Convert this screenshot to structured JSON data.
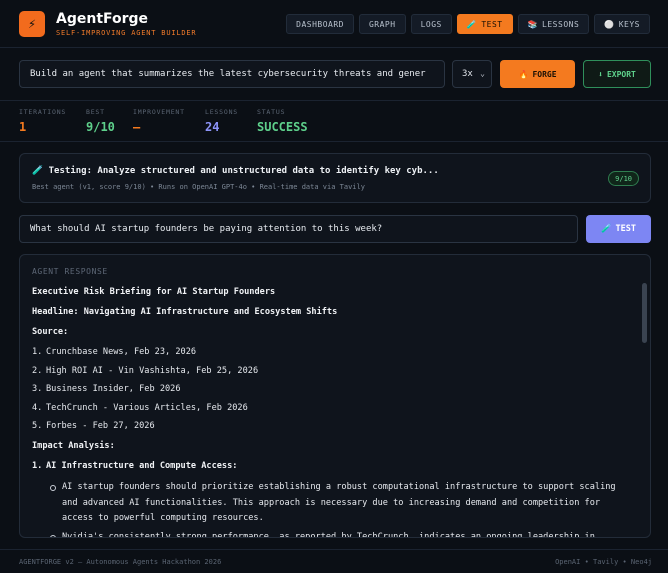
{
  "brand": {
    "logo_glyph": "⚡",
    "title": "AgentForge",
    "subtitle": "SELF-IMPROVING AGENT BUILDER"
  },
  "nav": {
    "dashboard": "DASHBOARD",
    "graph": "GRAPH",
    "logs": "LOGS",
    "test": "TEST",
    "test_icon": "🧪",
    "lessons": "LESSONS",
    "lessons_icon": "📚",
    "keys": "KEYS",
    "keys_icon": "⚪"
  },
  "prompt": {
    "value": "Build an agent that summarizes the latest cybersecurity threats and gener",
    "multiplier": "3x",
    "forge_label": "FORGE",
    "forge_icon": "🔥",
    "export_label": "EXPORT",
    "export_icon": "⬇"
  },
  "stats": {
    "iterations_label": "ITERATIONS",
    "iterations_value": "1",
    "best_label": "BEST",
    "best_value": "9/10",
    "improvement_label": "IMPROVEMENT",
    "improvement_value": "—",
    "lessons_label": "LESSONS",
    "lessons_value": "24",
    "status_label": "STATUS",
    "status_value": "SUCCESS"
  },
  "test_card": {
    "icon": "🧪",
    "title": "Testing: Analyze structured and unstructured data to identify key cyb...",
    "subtitle": "Best agent (v1, score 9/10) • Runs on OpenAI GPT-4o • Real-time data via Tavily",
    "score": "9/10"
  },
  "question": {
    "value": "What should AI startup founders be paying attention to this week?",
    "test_label": "TEST",
    "test_icon": "🧪"
  },
  "response": {
    "label": "AGENT RESPONSE",
    "heading1": "Executive Risk Briefing for AI Startup Founders",
    "heading2": "Headline: Navigating AI Infrastructure and Ecosystem Shifts",
    "source_heading": "Source:",
    "sources": [
      {
        "num": "1.",
        "text": "Crunchbase News, Feb 23, 2026"
      },
      {
        "num": "2.",
        "text": "High ROI AI - Vin Vashishta, Feb 25, 2026"
      },
      {
        "num": "3.",
        "text": "Business Insider, Feb 2026"
      },
      {
        "num": "4.",
        "text": "TechCrunch - Various Articles, Feb 2026"
      },
      {
        "num": "5.",
        "text": "Forbes - Feb 27, 2026"
      }
    ],
    "impact_heading": "Impact Analysis:",
    "impact_item_num": "1.",
    "impact_item_title": "AI Infrastructure and Compute Access:",
    "bullet1": "AI startup founders should prioritize establishing a robust computational infrastructure to support scaling and advanced AI functionalities. This approach is necessary due to increasing demand and competition for access to powerful computing resources.",
    "bullet2": "Nvidia's consistently strong performance, as reported by TechCrunch, indicates an ongoing leadership in"
  },
  "footer": {
    "left": "AGENTFORGE v2 — Autonomous Agents Hackathon 2026",
    "right": "OpenAI • Tavily • Neo4j"
  },
  "colors": {
    "accent": "#f47a1f",
    "success": "#5ed08b",
    "lessons": "#8c93f7",
    "test_button": "#7d86f3"
  }
}
